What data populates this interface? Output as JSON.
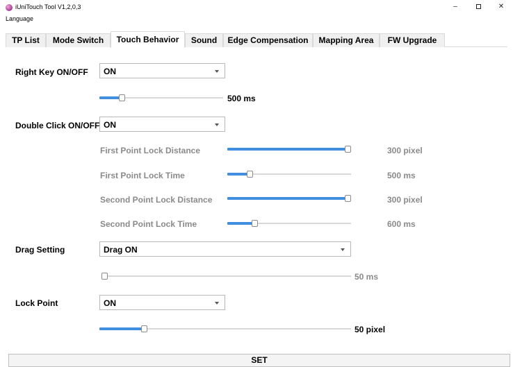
{
  "window": {
    "title": "iUniTouch Tool V1,2,0,3",
    "minimize": "–",
    "close": "✕"
  },
  "menu": {
    "language": "Language"
  },
  "tabs": [
    {
      "label": "TP List"
    },
    {
      "label": "Mode Switch"
    },
    {
      "label": "Touch Behavior",
      "active": true
    },
    {
      "label": "Sound"
    },
    {
      "label": "Edge Compensation"
    },
    {
      "label": "Mapping Area"
    },
    {
      "label": "FW Upgrade"
    }
  ],
  "right_key": {
    "label": "Right Key ON/OFF",
    "selected": "ON",
    "slider": {
      "value_text": "500 ms",
      "fraction": 0.17
    }
  },
  "double_click": {
    "label": "Double Click ON/OFF",
    "selected": "ON",
    "settings": [
      {
        "label": "First Point Lock Distance",
        "value_text": "300 pixel",
        "fraction": 1.0
      },
      {
        "label": "First Point Lock Time",
        "value_text": "500 ms",
        "fraction": 0.17
      },
      {
        "label": "Second Point Lock Distance",
        "value_text": "300 pixel",
        "fraction": 1.0
      },
      {
        "label": "Second Point Lock Time",
        "value_text": "600 ms",
        "fraction": 0.21
      }
    ]
  },
  "drag": {
    "label": "Drag Setting",
    "selected": "Drag ON",
    "slider": {
      "value_text": "50 ms",
      "fraction": 0.0
    }
  },
  "lock_point": {
    "label": "Lock Point",
    "selected": "ON",
    "slider": {
      "value_text": "50 pixel",
      "fraction": 0.17
    }
  },
  "set_button": {
    "label": "SET"
  }
}
